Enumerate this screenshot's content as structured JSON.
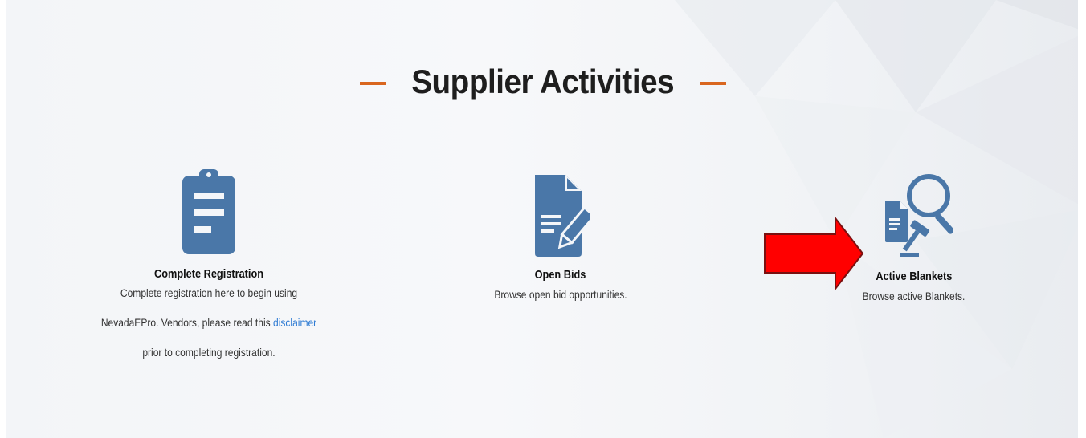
{
  "header": {
    "title": "Supplier Activities"
  },
  "cards": [
    {
      "title": "Complete Registration",
      "desc_line1": "Complete registration here to begin using",
      "desc_line2_pre": "NevadaEPro. Vendors, please read this",
      "link": "disclaimer",
      "desc_line3": "prior to completing registration.",
      "icon": "clipboard-icon"
    },
    {
      "title": "Open Bids",
      "desc": "Browse open bid opportunities.",
      "icon": "document-pencil-icon"
    },
    {
      "title": "Active Blankets",
      "desc": "Browse active Blankets.",
      "icon": "document-magnifier-gavel-icon"
    }
  ],
  "annotation": {
    "icon": "red-arrow-icon",
    "color": "#ff0000"
  },
  "colors": {
    "icon": "#4a77a8",
    "accent_dash": "#d9661f",
    "link": "#2e7bd3"
  }
}
